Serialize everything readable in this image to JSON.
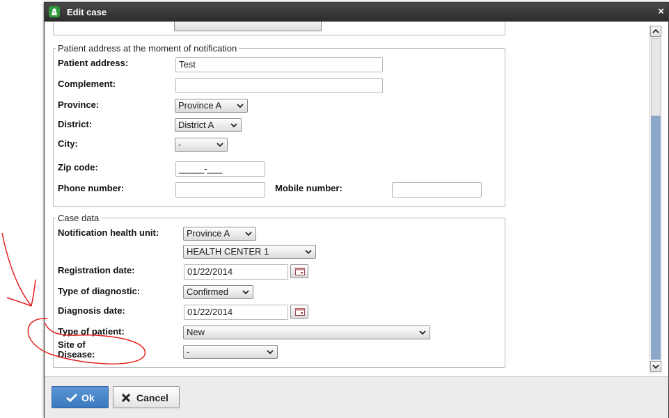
{
  "window": {
    "title": "Edit case",
    "close_icon": "×"
  },
  "address_section": {
    "legend": "Patient address at the moment of notification",
    "patient_address_label": "Patient address:",
    "patient_address_value": "Test",
    "complement_label": "Complement:",
    "complement_value": "",
    "province_label": "Province:",
    "province_value": "Province A",
    "district_label": "District:",
    "district_value": "District A",
    "city_label": "City:",
    "city_value": "-",
    "zip_label": "Zip code:",
    "zip_value": "_____-___",
    "phone_label": "Phone number:",
    "phone_value": "",
    "mobile_label": "Mobile number:",
    "mobile_value": ""
  },
  "case_section": {
    "legend": "Case data",
    "notification_unit_label": "Notification health unit:",
    "notification_province_value": "Province A",
    "notification_unit_value": "HEALTH CENTER 1",
    "registration_date_label": "Registration date:",
    "registration_date_value": "01/22/2014",
    "diagnostic_type_label": "Type of diagnostic:",
    "diagnostic_type_value": "Confirmed",
    "diagnosis_date_label": "Diagnosis date:",
    "diagnosis_date_value": "01/22/2014",
    "patient_type_label": "Type of patient:",
    "patient_type_value": "New",
    "site_label": "Site of Disease:",
    "site_value": "-"
  },
  "footer": {
    "ok_label": "Ok",
    "cancel_label": "Cancel"
  },
  "colors": {
    "titlebar": "#2b2b2b",
    "ok_button": "#3b78bd",
    "scroll_track": "#8aa7c9",
    "annotation": "#e0201c"
  },
  "icons": [
    "app-logo-icon",
    "close-icon",
    "calendar-icon",
    "check-icon",
    "x-icon",
    "chevron-down-icon",
    "scroll-up-icon",
    "scroll-down-icon"
  ]
}
